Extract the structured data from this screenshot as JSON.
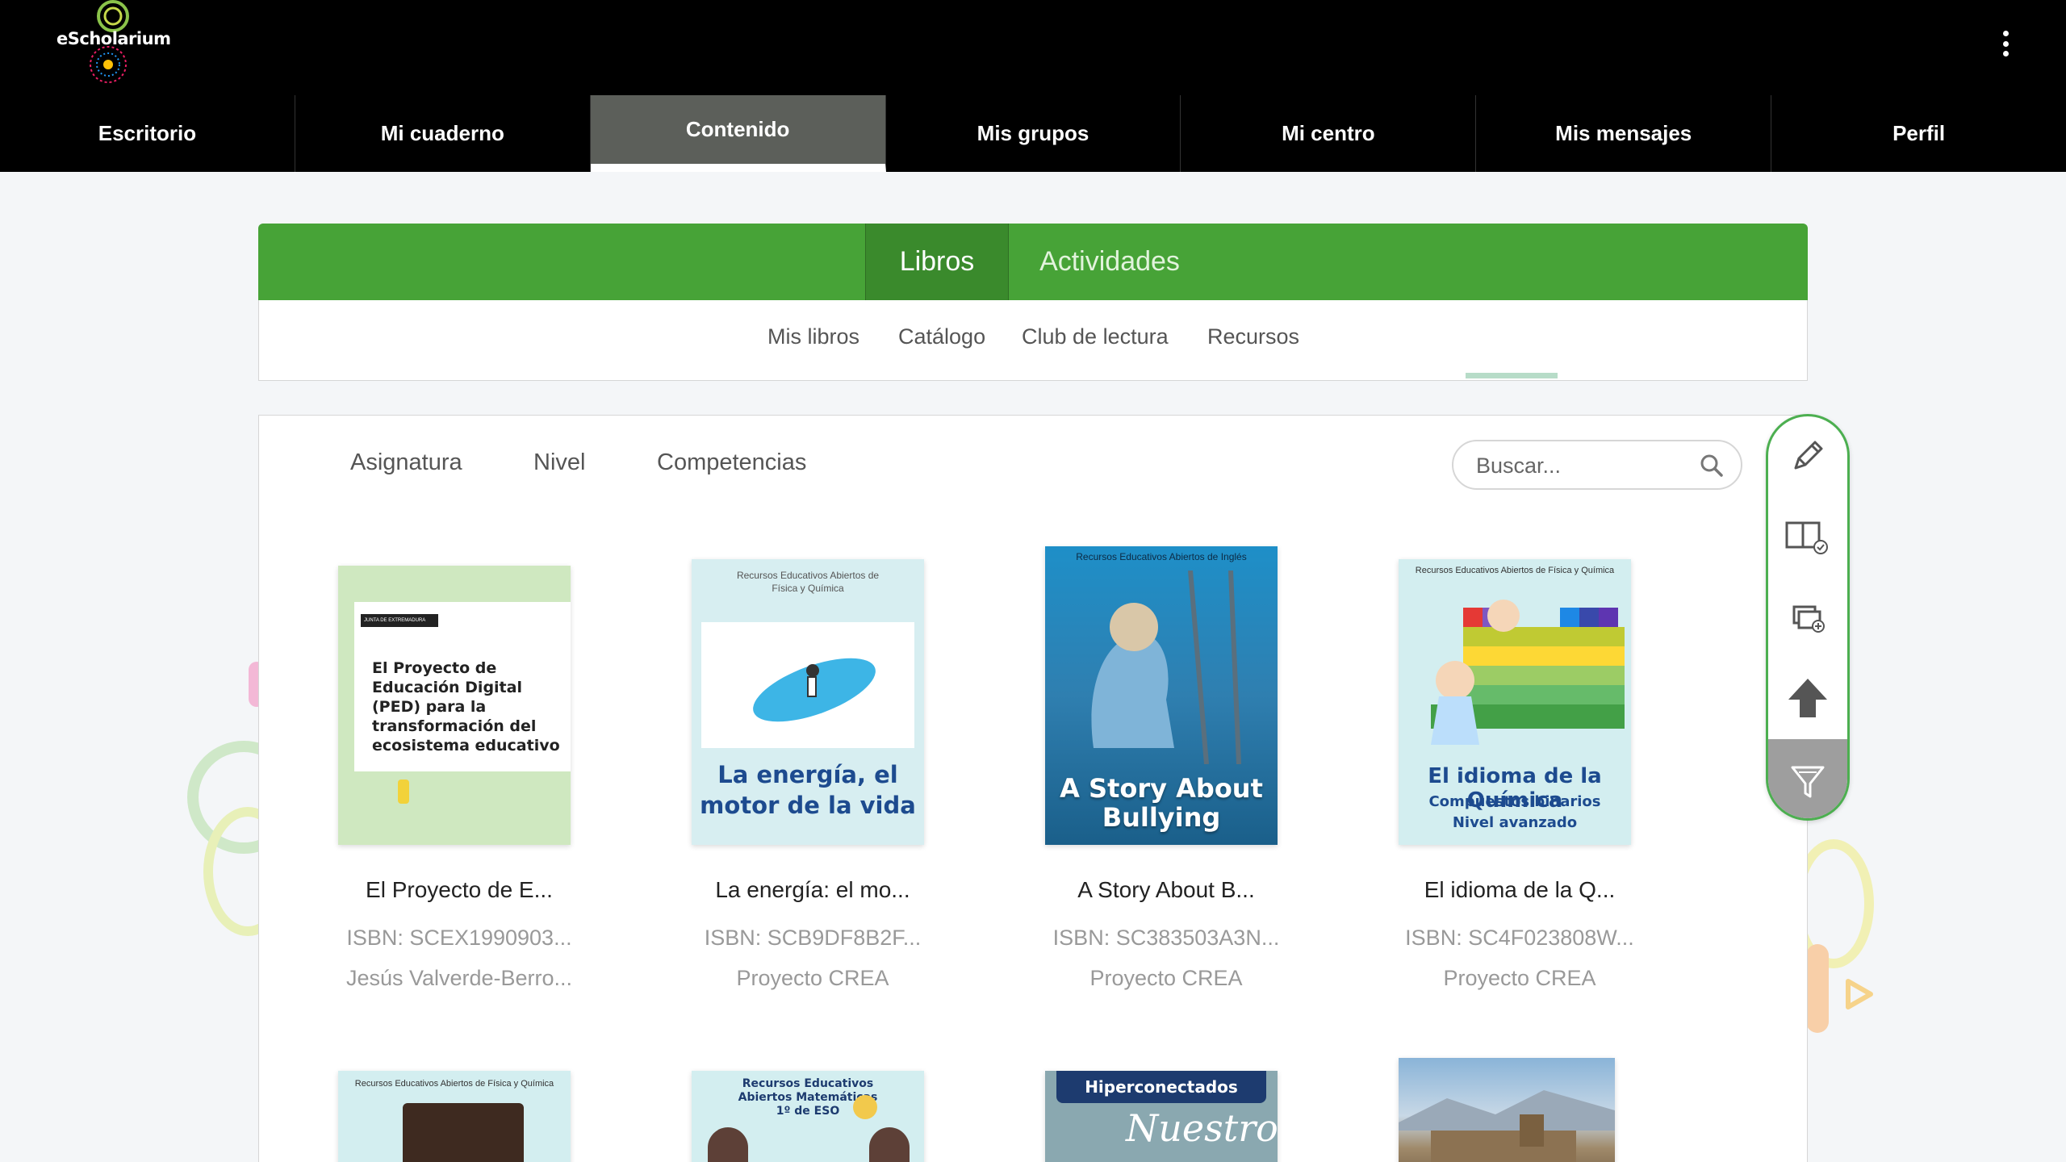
{
  "app": {
    "logo_text": "eScholarium"
  },
  "nav": {
    "items": [
      {
        "label": "Escritorio"
      },
      {
        "label": "Mi cuaderno"
      },
      {
        "label": "Contenido"
      },
      {
        "label": "Mis grupos"
      },
      {
        "label": "Mi centro"
      },
      {
        "label": "Mis mensajes"
      },
      {
        "label": "Perfil"
      }
    ],
    "active_index": 2
  },
  "main_tabs": [
    {
      "label": "Libros"
    },
    {
      "label": "Actividades"
    }
  ],
  "sub_tabs": [
    {
      "label": "Mis libros"
    },
    {
      "label": "Catálogo"
    },
    {
      "label": "Club de lectura"
    },
    {
      "label": "Recursos"
    }
  ],
  "filters": [
    {
      "label": "Asignatura"
    },
    {
      "label": "Nivel"
    },
    {
      "label": "Competencias"
    }
  ],
  "search": {
    "placeholder": "Buscar..."
  },
  "books": [
    {
      "title": "El Proyecto de E...",
      "isbn": "ISBN: SCEX1990903...",
      "author": "Jesús Valverde-Berro...",
      "cover_header": "JUNTA DE EXTREMADURA",
      "cover_text": "El Proyecto de Educación Digital (PED) para la transformación del ecosistema educativo"
    },
    {
      "title": "La energía: el mo...",
      "isbn": "ISBN: SCB9DF8B2F...",
      "author": "Proyecto CREA",
      "cover_header": "Recursos Educativos Abiertos de Física y Química",
      "cover_text": "La energía, el motor de la vida"
    },
    {
      "title": "A Story About B...",
      "isbn": "ISBN: SC383503A3N...",
      "author": "Proyecto CREA",
      "cover_header": "Recursos Educativos Abiertos de Inglés",
      "cover_text": "A Story About Bullying"
    },
    {
      "title": "El idioma de la Q...",
      "isbn": "ISBN: SC4F023808W...",
      "author": "Proyecto CREA",
      "cover_header": "Recursos Educativos Abiertos de Física y Química",
      "cover_text": "El idioma de la Química",
      "cover_sub1": "Compuestos binarios",
      "cover_sub2": "Nivel avanzado"
    }
  ],
  "books_row2": [
    {
      "cover_header": "Recursos Educativos Abiertos de Física y Química"
    },
    {
      "cover_header": "Recursos Educativos Abiertos Matemáticas 1º de ESO"
    },
    {
      "cover_header": "Hiperconectados",
      "cover_script": "Nuestro"
    },
    {
      "cover_header": ""
    }
  ],
  "colors": {
    "nav_bg": "#000000",
    "nav_active": "#5c5f5a",
    "tabs_green": "#47a337",
    "toolbar_border": "#4caf50"
  }
}
